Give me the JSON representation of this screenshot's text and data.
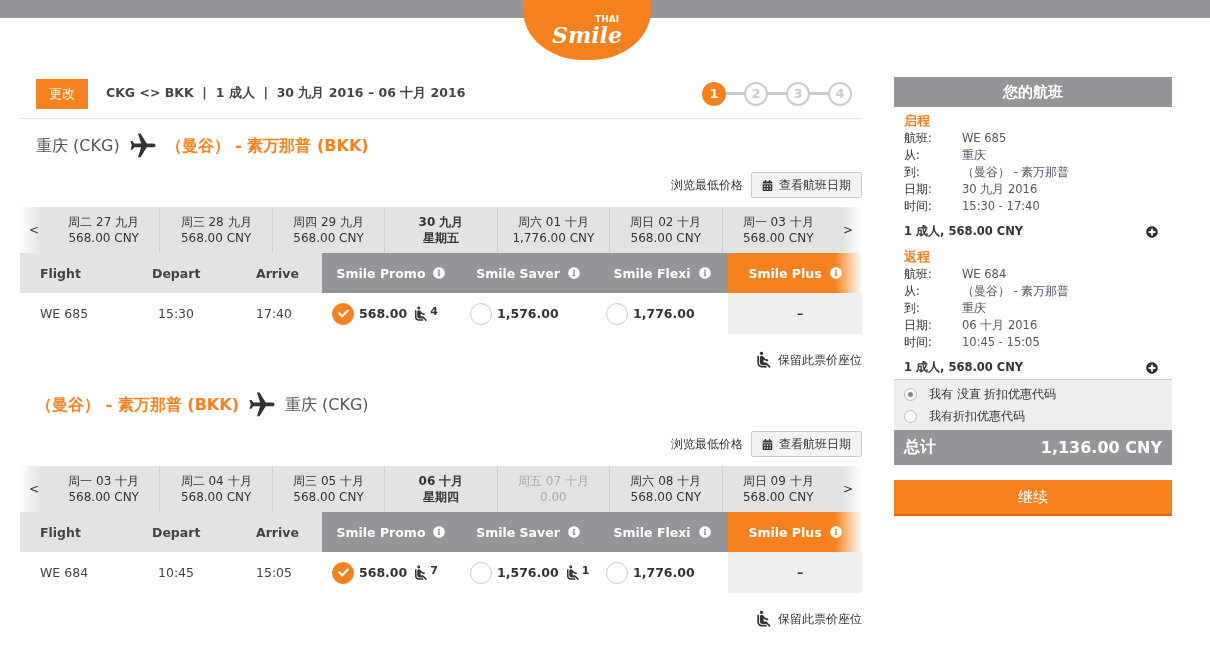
{
  "logo": {
    "brand_small": "THAI",
    "brand": "Smile"
  },
  "search_bar": {
    "change_button": "更改",
    "summary": "CKG <> BKK  |  1 成人  |  30 九月 2016 – 06 十月 2016"
  },
  "steps": [
    {
      "label": "1",
      "selected": true
    },
    {
      "label": "2",
      "selected": false
    },
    {
      "label": "3",
      "selected": false
    },
    {
      "label": "4",
      "selected": false
    }
  ],
  "legs": [
    {
      "from": {
        "name": "重庆 (CKG)",
        "highlight": false
      },
      "to": {
        "name": "（曼谷） - 素万那普 (BKK)",
        "highlight": true
      },
      "browse_label": "浏览最低价格",
      "calendar_button": "查看航班日期",
      "prev": "<",
      "next": ">",
      "dates": [
        {
          "line1": "周二 27 九月",
          "line2": "568.00 CNY",
          "selected": false,
          "disabled": false
        },
        {
          "line1": "周三 28 九月",
          "line2": "568.00 CNY",
          "selected": false,
          "disabled": false
        },
        {
          "line1": "周四 29 九月",
          "line2": "568.00 CNY",
          "selected": false,
          "disabled": false
        },
        {
          "line1": "30 九月",
          "line2": "星期五",
          "selected": true,
          "disabled": false
        },
        {
          "line1": "周六 01 十月",
          "line2": "1,776.00 CNY",
          "selected": false,
          "disabled": false
        },
        {
          "line1": "周日 02 十月",
          "line2": "568.00 CNY",
          "selected": false,
          "disabled": false
        },
        {
          "line1": "周一 03 十月",
          "line2": "568.00 CNY",
          "selected": false,
          "disabled": false
        }
      ],
      "columns": [
        "Flight",
        "Depart",
        "Arrive"
      ],
      "fare_types": [
        {
          "name": "Smile Promo",
          "highlight": false
        },
        {
          "name": "Smile Saver",
          "highlight": false
        },
        {
          "name": "Smile Flexi",
          "highlight": false
        },
        {
          "name": "Smile Plus",
          "highlight": true
        }
      ],
      "row": {
        "flight": "WE 685",
        "depart": "15:30",
        "arrive": "17:40",
        "fares": [
          {
            "kind": "option",
            "price": "568.00",
            "selected": true,
            "seats": "4"
          },
          {
            "kind": "option",
            "price": "1,576.00",
            "selected": false
          },
          {
            "kind": "option",
            "price": "1,776.00",
            "selected": false
          },
          {
            "kind": "unavailable",
            "price": "–"
          }
        ]
      },
      "hold_note": "保留此票价座位"
    },
    {
      "from": {
        "name": "（曼谷） - 素万那普 (BKK)",
        "highlight": true
      },
      "to": {
        "name": "重庆 (CKG)",
        "highlight": false
      },
      "browse_label": "浏览最低价格",
      "calendar_button": "查看航班日期",
      "prev": "<",
      "next": ">",
      "dates": [
        {
          "line1": "周一 03 十月",
          "line2": "568.00 CNY",
          "selected": false,
          "disabled": false
        },
        {
          "line1": "周二 04 十月",
          "line2": "568.00 CNY",
          "selected": false,
          "disabled": false
        },
        {
          "line1": "周三 05 十月",
          "line2": "568.00 CNY",
          "selected": false,
          "disabled": false
        },
        {
          "line1": "06 十月",
          "line2": "星期四",
          "selected": true,
          "disabled": false
        },
        {
          "line1": "周五 07 十月",
          "line2": "0.00",
          "selected": false,
          "disabled": true
        },
        {
          "line1": "周六 08 十月",
          "line2": "568.00 CNY",
          "selected": false,
          "disabled": false
        },
        {
          "line1": "周日 09 十月",
          "line2": "568.00 CNY",
          "selected": false,
          "disabled": false
        }
      ],
      "columns": [
        "Flight",
        "Depart",
        "Arrive"
      ],
      "fare_types": [
        {
          "name": "Smile Promo",
          "highlight": false
        },
        {
          "name": "Smile Saver",
          "highlight": false
        },
        {
          "name": "Smile Flexi",
          "highlight": false
        },
        {
          "name": "Smile Plus",
          "highlight": true
        }
      ],
      "row": {
        "flight": "WE 684",
        "depart": "10:45",
        "arrive": "15:05",
        "fares": [
          {
            "kind": "option",
            "price": "568.00",
            "selected": true,
            "seats": "7"
          },
          {
            "kind": "option",
            "price": "1,576.00",
            "selected": false,
            "seats": "1"
          },
          {
            "kind": "option",
            "price": "1,776.00",
            "selected": false
          },
          {
            "kind": "unavailable",
            "price": "–"
          }
        ]
      },
      "hold_note": "保留此票价座位"
    }
  ],
  "sidebar": {
    "title": "您的航班",
    "sections": [
      {
        "heading": "启程",
        "rows": [
          {
            "label": "航班:",
            "value": "WE 685"
          },
          {
            "label": "从:",
            "value": "重庆"
          },
          {
            "label": "到:",
            "value": "（曼谷） - 素万那普"
          },
          {
            "label": "日期:",
            "value": "30 九月 2016"
          },
          {
            "label": "时间:",
            "value": "15:30 - 17:40"
          }
        ],
        "subtotal": "1 成人, 568.00 CNY"
      },
      {
        "heading": "返程",
        "rows": [
          {
            "label": "航班:",
            "value": "WE 684"
          },
          {
            "label": "从:",
            "value": "（曼谷） - 素万那普"
          },
          {
            "label": "到:",
            "value": "重庆"
          },
          {
            "label": "日期:",
            "value": "06 十月 2016"
          },
          {
            "label": "时间:",
            "value": "10:45 - 15:05"
          }
        ],
        "subtotal": "1 成人, 568.00 CNY"
      }
    ],
    "promo_options": [
      {
        "label": "我有 没直 折扣优惠代码",
        "selected": true
      },
      {
        "label": "我有折扣优惠代码",
        "selected": false
      }
    ],
    "total_label": "总计",
    "total": "1,136.00 CNY",
    "continue_button": "继续"
  }
}
